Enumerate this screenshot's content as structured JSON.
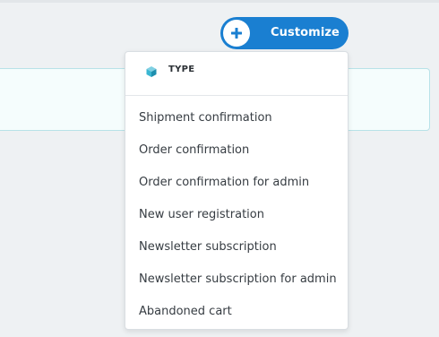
{
  "customize_button": {
    "label": "Customize",
    "icon": "plus-icon"
  },
  "dropdown": {
    "header": {
      "icon": "cube-icon",
      "label": "TYPE"
    },
    "items": [
      {
        "label": "Shipment confirmation"
      },
      {
        "label": "Order confirmation"
      },
      {
        "label": "Order confirmation for admin"
      },
      {
        "label": "New user registration"
      },
      {
        "label": "Newsletter subscription"
      },
      {
        "label": "Newsletter subscription for admin"
      },
      {
        "label": "Abandoned cart"
      }
    ]
  },
  "colors": {
    "accent": "#1a7fd1",
    "background": "#eef1f3",
    "panel_bg": "#f5fdfd",
    "panel_border": "#b8e2e8",
    "icon_teal": "#3ab6d2"
  }
}
